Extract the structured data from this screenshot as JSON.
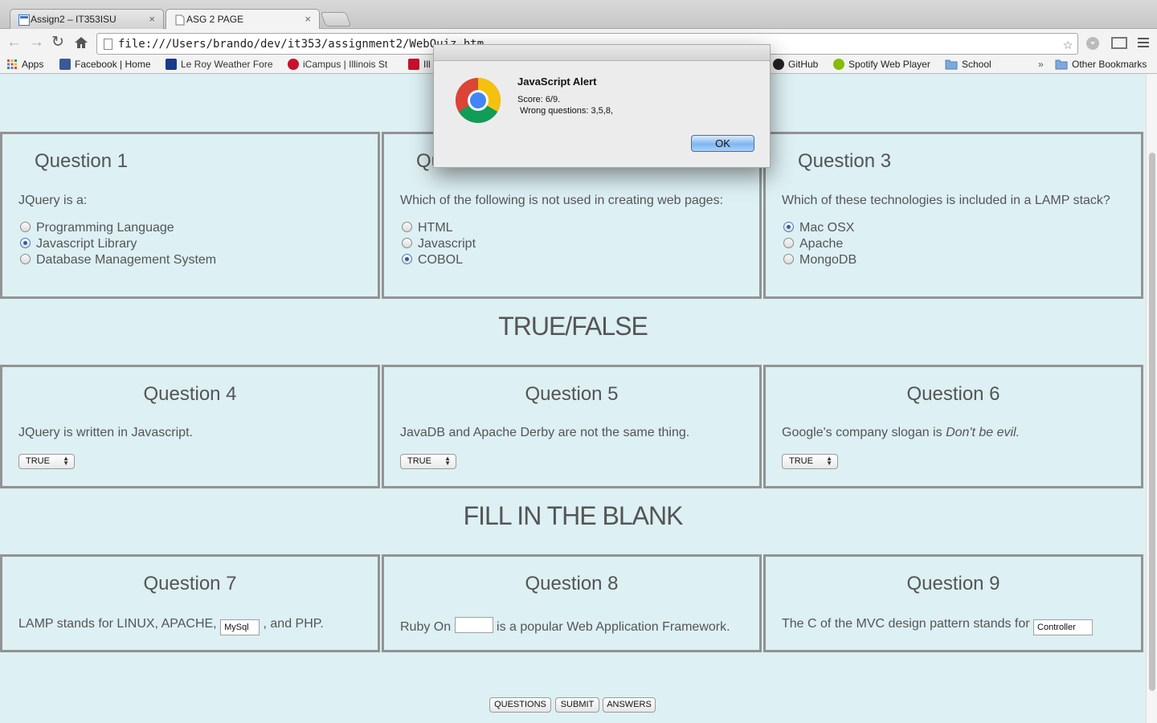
{
  "browser": {
    "tabs": [
      {
        "title": "Assign2 – IT353ISU",
        "close": "×"
      },
      {
        "title": "ASG 2 PAGE",
        "close": "×"
      }
    ],
    "url": "file:///Users/brando/dev/it353/assignment2/WebQuiz.htm",
    "bookmarks": [
      {
        "label": "Apps"
      },
      {
        "label": "Facebook | Home"
      },
      {
        "label": "Le Roy Weather Fore"
      },
      {
        "label": "iCampus | Illinois St"
      },
      {
        "label": "Ill"
      },
      {
        "label": "GitHub"
      },
      {
        "label": "Spotify Web Player"
      },
      {
        "label": "School"
      },
      {
        "label": "»"
      },
      {
        "label": "Other Bookmarks"
      }
    ]
  },
  "alert": {
    "title": "JavaScript Alert",
    "line1": "Score: 6/9.",
    "line2": " Wrong questions: 3,5,8,",
    "ok": "OK"
  },
  "sections": {
    "true_false": "TRUE/FALSE",
    "fill_blank": "FILL IN THE BLANK"
  },
  "questions": {
    "q1": {
      "title": "Question 1",
      "text": "JQuery is a:",
      "options": [
        "Programming Language",
        "Javascript Library",
        "Database Management System"
      ],
      "selected_index": 1
    },
    "q2": {
      "title": "Question 2",
      "text": "Which of the following is not used in creating web pages:",
      "options": [
        "HTML",
        "Javascript",
        "COBOL"
      ],
      "selected_index": 2
    },
    "q3": {
      "title": "Question 3",
      "text": "Which of these technologies is included in a LAMP stack?",
      "options": [
        "Mac OSX",
        "Apache",
        "MongoDB"
      ],
      "selected_index": 0
    },
    "q4": {
      "title": "Question 4",
      "text": "JQuery is written in Javascript.",
      "select_value": "TRUE"
    },
    "q5": {
      "title": "Question 5",
      "text": "JavaDB and Apache Derby are not the same thing.",
      "select_value": "TRUE"
    },
    "q6": {
      "title": "Question 6",
      "text_prefix": "Google's company slogan is ",
      "text_emph": "Don't be evil.",
      "select_value": "TRUE"
    },
    "q7": {
      "title": "Question 7",
      "text_before": "LAMP stands for LINUX, APACHE, ",
      "value": "MySql",
      "text_after": " , and PHP."
    },
    "q8": {
      "title": "Question 8",
      "text_before": "Ruby On ",
      "value": "",
      "text_after": " is a popular Web Application Framework."
    },
    "q9": {
      "title": "Question 9",
      "text_before": "The C of the MVC design pattern stands for ",
      "value": "Controller",
      "text_after": ""
    }
  },
  "buttons": {
    "questions": "QUESTIONS",
    "submit": "SUBMIT",
    "answers": "ANSWERS"
  },
  "colors": {
    "page_bg": "#ddf0f3",
    "box_border": "#939393",
    "text": "#555555"
  }
}
